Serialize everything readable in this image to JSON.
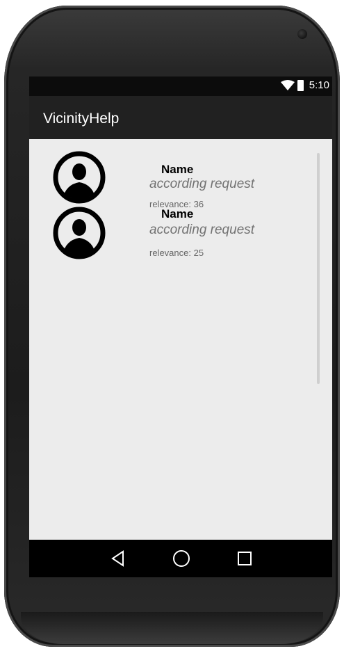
{
  "status_bar": {
    "time": "5:10"
  },
  "app_bar": {
    "title": "VicinityHelp"
  },
  "results": [
    {
      "name": "Name",
      "subtitle": "according request",
      "relevance": "relevance: 36"
    },
    {
      "name": "Name",
      "subtitle": "according request",
      "relevance": "relevance: 25"
    }
  ],
  "nav": {
    "back": "back-icon",
    "home": "home-icon",
    "recents": "recents-icon"
  }
}
